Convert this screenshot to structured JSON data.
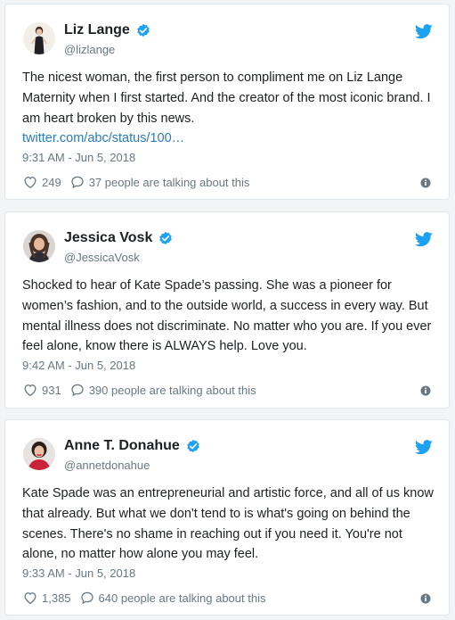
{
  "colors": {
    "link": "#2b7bb9",
    "verified": "#1da1f2",
    "twitter_bird": "#1da1f2",
    "meta_text": "#697882",
    "body_text": "#1c2022"
  },
  "tweets": [
    {
      "name": "Liz Lange",
      "handle": "@lizlange",
      "text": "The nicest woman, the first person to compliment me on Liz Lange Maternity when I first started. And the creator of the most iconic brand. I am heart broken by this news.",
      "link": "twitter.com/abc/status/100…",
      "timestamp": "9:31 AM - Jun 5, 2018",
      "likes": "249",
      "replies": "37 people are talking about this",
      "avatar_icon": "person-photo-avatar",
      "verified_icon": "verified-badge-icon",
      "brand_icon": "twitter-bird-icon"
    },
    {
      "name": "Jessica Vosk",
      "handle": "@JessicaVosk",
      "text": "Shocked to hear of Kate Spade’s passing. She was a pioneer for women’s fashion, and to the outside world, a success in every way. But mental illness does not discriminate. No matter who you are. If you ever feel alone, know there is ALWAYS help. Love you.",
      "timestamp": "9:42 AM - Jun 5, 2018",
      "likes": "931",
      "replies": "390 people are talking about this",
      "avatar_icon": "person-photo-avatar",
      "verified_icon": "verified-badge-icon",
      "brand_icon": "twitter-bird-icon"
    },
    {
      "name": "Anne T. Donahue",
      "handle": "@annetdonahue",
      "text": "Kate Spade was an entrepreneurial and artistic force, and all of us know that already. But what we don't tend to is what's going on behind the scenes. There's no shame in reaching out if you need it. You're not alone, no matter how alone you may feel.",
      "timestamp": "9:33 AM - Jun 5, 2018",
      "likes": "1,385",
      "replies": "640 people are talking about this",
      "avatar_icon": "person-photo-avatar",
      "verified_icon": "verified-badge-icon",
      "brand_icon": "twitter-bird-icon"
    }
  ]
}
